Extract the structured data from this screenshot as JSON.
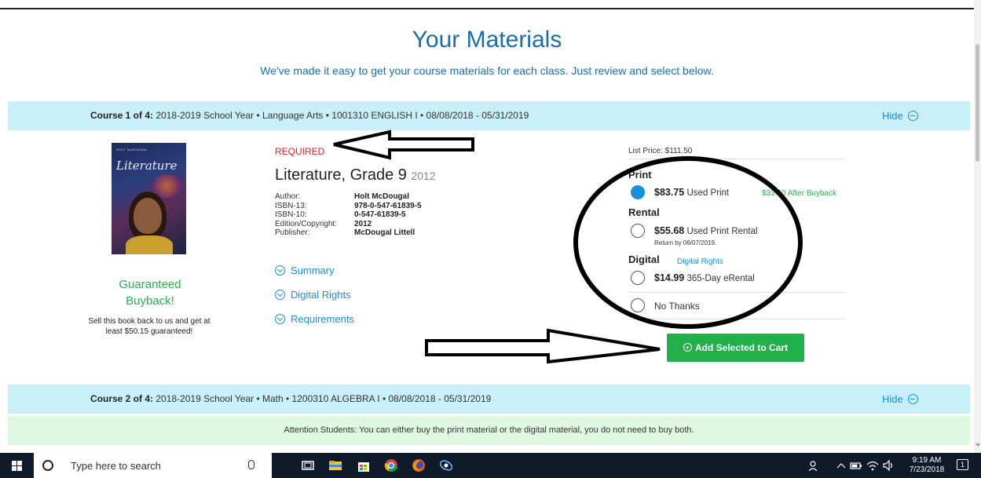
{
  "header": {
    "title": "Your Materials",
    "subtitle": "We've made it easy to get your course materials for each class. Just review and select below."
  },
  "course1": {
    "label": "Course 1 of 4:",
    "info": "2018-2019 School Year • Language Arts • 1001310 ENGLISH I • 08/08/2018 - 05/31/2019",
    "hide_label": "Hide"
  },
  "book": {
    "cover_title": "Literature",
    "cover_publisher": "HOLT McDOUGAL",
    "required_label": "REQUIRED",
    "title": "Literature, Grade 9",
    "year": "2012",
    "details": [
      {
        "label": "Author:",
        "value": "Holt McDougal"
      },
      {
        "label": "ISBN-13:",
        "value": "978-0-547-61839-5"
      },
      {
        "label": "ISBN-10:",
        "value": "0-547-61839-5"
      },
      {
        "label": "Edition/Copyright:",
        "value": "2012"
      },
      {
        "label": "Publisher:",
        "value": "McDougal Littell"
      }
    ],
    "links": {
      "summary": "Summary",
      "digital_rights": "Digital Rights",
      "requirements": "Requirements"
    }
  },
  "buyback": {
    "title": "Guaranteed Buyback!",
    "text": "Sell this book back to us and get at least $50.15 guaranteed!"
  },
  "options": {
    "list_price": "List Price: $111.50",
    "print_heading": "Print",
    "print_price": "$83.75",
    "print_label": "Used Print",
    "after_buyback": "$33.60 After Buyback",
    "rental_heading": "Rental",
    "rental_price": "$55.68",
    "rental_label": "Used Print Rental",
    "rental_note": "Return by 06/07/2019.",
    "digital_heading": "Digital",
    "digital_rights_link": "Digital Rights",
    "digital_price": "$14.99",
    "digital_label": "365-Day eRental",
    "no_thanks_label": "No Thanks",
    "selected": "print"
  },
  "cart": {
    "add_label": "Add Selected to Cart"
  },
  "course2": {
    "label": "Course 2 of 4:",
    "info": "2018-2019 School Year • Math • 1200310 ALGEBRA I • 08/08/2018 - 05/31/2019",
    "hide_label": "Hide"
  },
  "notice": {
    "text": "Attention Students: You can either buy the print material or the digital material, you do not need to buy both."
  },
  "taskbar": {
    "search_placeholder": "Type here to search",
    "time": "9:19 AM",
    "date": "7/23/2018",
    "notification_count": "1"
  },
  "colors": {
    "accent_blue": "#1a6ea8",
    "link_blue": "#1a8fd8",
    "green": "#22b04a",
    "required_red": "#d8242a",
    "course_bar": "#c9f0f8",
    "notice_bg": "#def9df"
  }
}
